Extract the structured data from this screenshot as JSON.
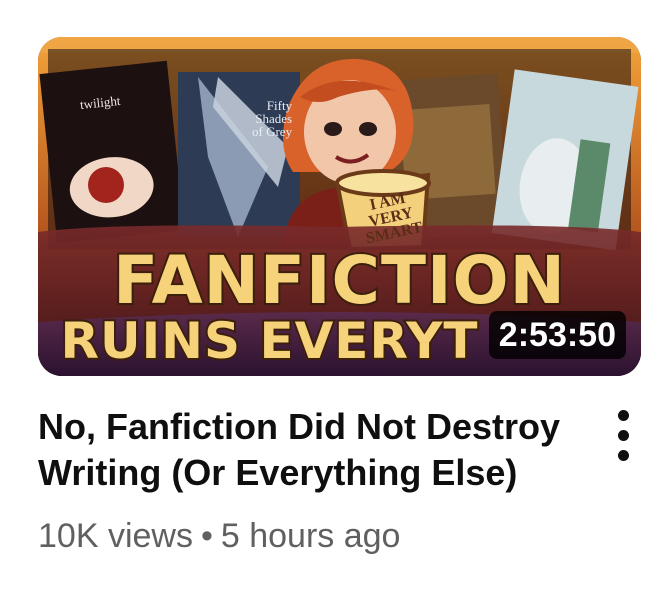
{
  "video": {
    "thumbnail": {
      "overlay_line1": "FANFICTION",
      "overlay_line2": "RUINS EVERYT",
      "duration": "2:53:50",
      "book_twilight": "twilight",
      "book_fifty": "Fifty Shades of Grey",
      "book_fifty_l1": "Fifty",
      "book_fifty_l2": "Shades",
      "book_fifty_l3": "of Grey",
      "cup_l1": "I AM",
      "cup_l2": "VERY",
      "cup_l3": "SMART",
      "icons": {
        "avatar_character": "cartoon-woman-with-mug-icon"
      }
    },
    "title": "No, Fanfiction Did Not Destroy Writing (Or Everything Else)",
    "views": "10K views",
    "separator": "•",
    "age": "5 hours ago",
    "menu_icon": "more-vert-icon"
  },
  "colors": {
    "title_text": "#0f0f0f",
    "meta_text": "#606060",
    "overlay_text": "#f6d27a",
    "duration_bg": "#000000"
  }
}
